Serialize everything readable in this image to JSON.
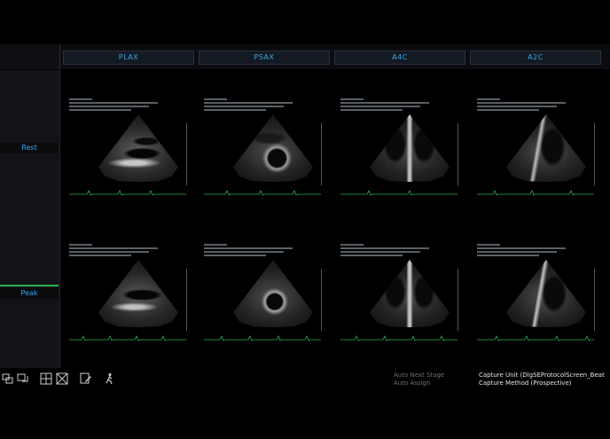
{
  "columns": [
    "PLAX",
    "PSAX",
    "A4C",
    "A2C"
  ],
  "rows": [
    {
      "label": "Rest",
      "active": false
    },
    {
      "label": "Peak",
      "active": true
    }
  ],
  "toolbar": {
    "icons": [
      "layout-icon",
      "compare-icon",
      "grid-view-icon",
      "split-view-icon",
      "edit-report-icon",
      "walking-person-icon"
    ]
  },
  "status": {
    "auto_next_stage": "Auto Next Stage",
    "auto_assign": "Auto Assign",
    "capture_unit": "Capture Unit (DlgSEProtocolScreen_Beat",
    "capture_method": "Capture Method (Prospective)"
  },
  "colors": {
    "accent": "#39a8f0",
    "active_row": "#2bb24c",
    "ecg_trace": "#2bb24c"
  }
}
